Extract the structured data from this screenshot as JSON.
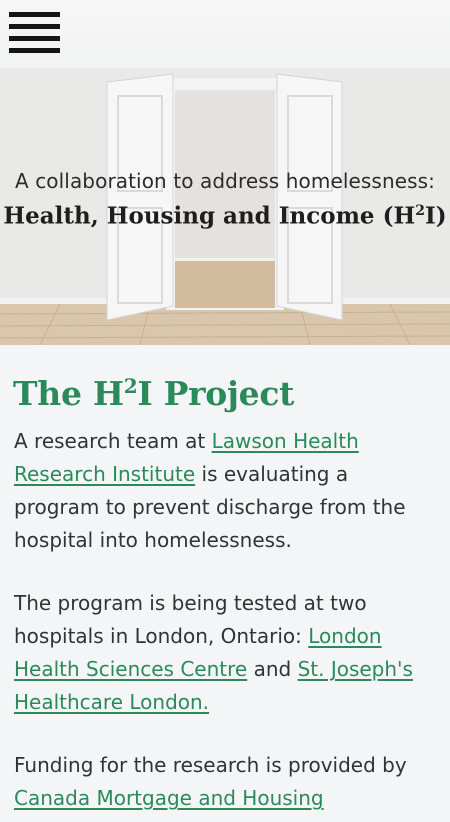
{
  "nav": {
    "menu_icon": "hamburger-menu-icon"
  },
  "hero": {
    "subtitle": "A collaboration to address homelessness:",
    "title_main": "Health, Housing and Income (H",
    "title_sup": "2",
    "title_end": "I)",
    "image": "open-double-doors-room-image"
  },
  "section": {
    "title_pre": "The H",
    "title_sup": "2",
    "title_post": "I Project"
  },
  "paragraphs": {
    "p1_before": "A research team at ",
    "p1_link": "Lawson Health Research Institute",
    "p1_after": " is evaluating a program to prevent discharge from the hospital into homelessness.",
    "p2_before": "The program is being tested at two hospitals in London, Ontario: ",
    "p2_link1": "London Health Sciences Centre",
    "p2_mid": " and ",
    "p2_link2": "St. Joseph's Healthcare London.",
    "p3_before": "Funding for the research is provided by ",
    "p3_link": "Canada Mortgage and Housing"
  },
  "colors": {
    "accent": "#2b8a5a",
    "text": "#333333",
    "background": "#f4f5f6"
  }
}
